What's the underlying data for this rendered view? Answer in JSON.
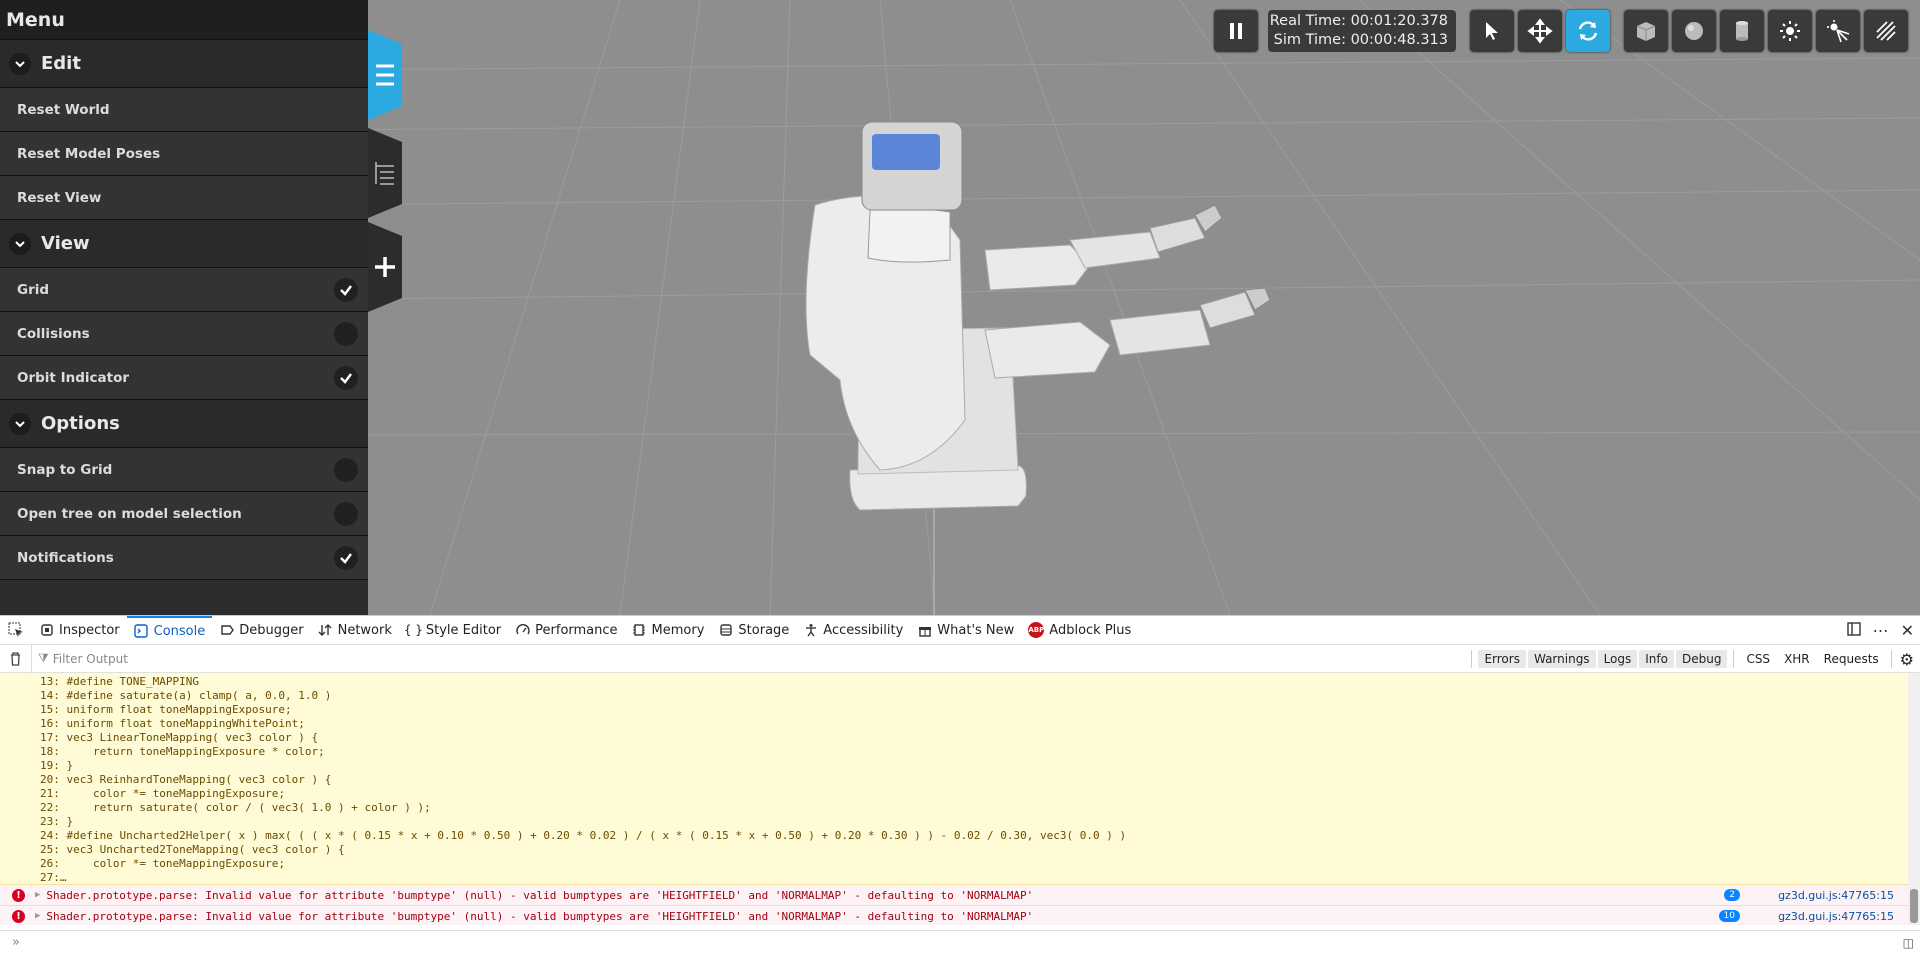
{
  "menu": {
    "title": "Menu",
    "sections": [
      {
        "label": "Edit",
        "items": [
          {
            "label": "Reset World",
            "toggle": null
          },
          {
            "label": "Reset Model Poses",
            "toggle": null
          },
          {
            "label": "Reset View",
            "toggle": null
          }
        ]
      },
      {
        "label": "View",
        "items": [
          {
            "label": "Grid",
            "toggle": true
          },
          {
            "label": "Collisions",
            "toggle": false
          },
          {
            "label": "Orbit Indicator",
            "toggle": true
          }
        ]
      },
      {
        "label": "Options",
        "items": [
          {
            "label": "Snap to Grid",
            "toggle": false
          },
          {
            "label": "Open tree on model selection",
            "toggle": false
          },
          {
            "label": "Notifications",
            "toggle": true
          }
        ]
      }
    ]
  },
  "toolbar": {
    "real_time": "Real Time: 00:01:20.378",
    "sim_time": "Sim Time: 00:00:48.313",
    "active_tool": "rotate-icon",
    "accent_color": "#2ba9e0"
  },
  "devtools": {
    "tabs": [
      {
        "label": "Inspector",
        "icon": "inspector-icon"
      },
      {
        "label": "Console",
        "icon": "console-icon",
        "active": true
      },
      {
        "label": "Debugger",
        "icon": "debugger-icon"
      },
      {
        "label": "Network",
        "icon": "network-icon"
      },
      {
        "label": "Style Editor",
        "icon": "style-editor-icon"
      },
      {
        "label": "Performance",
        "icon": "performance-icon"
      },
      {
        "label": "Memory",
        "icon": "memory-icon"
      },
      {
        "label": "Storage",
        "icon": "storage-icon"
      },
      {
        "label": "Accessibility",
        "icon": "accessibility-icon"
      },
      {
        "label": "What's New",
        "icon": "whats-new-icon"
      },
      {
        "label": "Adblock Plus",
        "icon": "adblock-icon"
      }
    ],
    "filter_placeholder": "Filter Output",
    "filters": [
      "Errors",
      "Warnings",
      "Logs",
      "Info",
      "Debug"
    ],
    "extra_filters": [
      "CSS",
      "XHR",
      "Requests"
    ],
    "code_lines": [
      "13: #define TONE_MAPPING",
      "14: #define saturate(a) clamp( a, 0.0, 1.0 )",
      "15: uniform float toneMappingExposure;",
      "16: uniform float toneMappingWhitePoint;",
      "17: vec3 LinearToneMapping( vec3 color ) {",
      "18:     return toneMappingExposure * color;",
      "19: }",
      "20: vec3 ReinhardToneMapping( vec3 color ) {",
      "21:     color *= toneMappingExposure;",
      "22:     return saturate( color / ( vec3( 1.0 ) + color ) );",
      "23: }",
      "24: #define Uncharted2Helper( x ) max( ( ( x * ( 0.15 * x + 0.10 * 0.50 ) + 0.20 * 0.02 ) / ( x * ( 0.15 * x + 0.50 ) + 0.20 * 0.30 ) ) - 0.02 / 0.30, vec3( 0.0 ) )",
      "25: vec3 Uncharted2ToneMapping( vec3 color ) {",
      "26:     color *= toneMappingExposure;",
      "27:…"
    ],
    "errors": [
      {
        "message": "Shader.prototype.parse: Invalid value for attribute 'bumptype' (null) - valid bumptypes are 'HEIGHTFIELD' and 'NORMALMAP' - defaulting to 'NORMALMAP'",
        "count": "2",
        "source": "gz3d.gui.js:47765:15"
      },
      {
        "message": "Shader.prototype.parse: Invalid value for attribute 'bumptype' (null) - valid bumptypes are 'HEIGHTFIELD' and 'NORMALMAP' - defaulting to 'NORMALMAP'",
        "count": "10",
        "source": "gz3d.gui.js:47765:15"
      }
    ],
    "prompt": "»"
  }
}
